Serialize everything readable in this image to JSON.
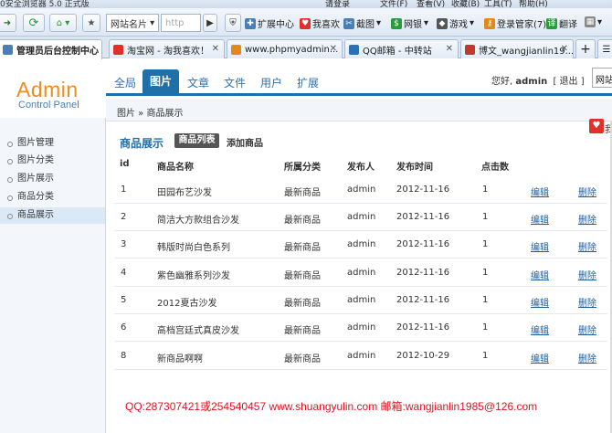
{
  "browser": {
    "title": "0安全浏览器 5.0 正式版",
    "menus": [
      "请登录",
      "文件(F)",
      "查看(V)",
      "收藏(B)",
      "工具(T)",
      "帮助(H)"
    ],
    "address_label": "网站名片",
    "address_value": "http",
    "toolbar_links": [
      {
        "label": "扩展中心",
        "icon": "puzzle-icon",
        "color": "#4a7fb5"
      },
      {
        "label": "我喜欢",
        "icon": "heart-icon",
        "color": "#e0302a"
      },
      {
        "label": "截图",
        "icon": "scissors-icon",
        "color": "#4a7fb5"
      },
      {
        "label": "网银",
        "icon": "bank-icon",
        "color": "#2a9a3a"
      },
      {
        "label": "游戏",
        "icon": "gamepad-icon",
        "color": "#555555"
      },
      {
        "label": "登录管家(7)",
        "icon": "key-icon",
        "color": "#e08a1e"
      },
      {
        "label": "翻译",
        "icon": "translate-icon",
        "color": "#2a9a3a"
      }
    ],
    "tabs": [
      {
        "label": "管理员后台控制中心",
        "active": true,
        "color": "#4a7fb5"
      },
      {
        "label": "淘宝网 - 淘我喜欢！",
        "active": false,
        "color": "#e0302a"
      },
      {
        "label": "www.phpmyadmin...",
        "active": false,
        "color": "#e08a1e"
      },
      {
        "label": "QQ邮箱 - 中转站",
        "active": false,
        "color": "#2a72b5"
      },
      {
        "label": "博文_wangjianlin19...",
        "active": false,
        "color": "#c0392b"
      }
    ]
  },
  "logo": {
    "title": "Admin",
    "subtitle": "Control Panel"
  },
  "nav": {
    "items": [
      "全局",
      "图片",
      "文章",
      "文件",
      "用户",
      "扩展"
    ],
    "active_index": 1
  },
  "user": {
    "greeting": "您好,",
    "name": "admin",
    "logout": "[ 退出 ]",
    "search_placeholder": "网站"
  },
  "breadcrumb": "图片 » 商品展示",
  "sidebar": {
    "items": [
      "图片管理",
      "图片分类",
      "图片展示",
      "商品分类",
      "商品展示"
    ],
    "active_index": 4
  },
  "content": {
    "title": "商品展示",
    "list_button": "商品列表",
    "add_button": "添加商品",
    "headers": {
      "id": "id",
      "name": "商品名称",
      "category": "所属分类",
      "publisher": "发布人",
      "time": "发布时间",
      "clicks": "点击数"
    },
    "edit_label": "编辑",
    "delete_label": "删除",
    "rows": [
      {
        "id": "1",
        "name": "田园布艺沙发",
        "category": "最新商品",
        "publisher": "admin",
        "time": "2012-11-16",
        "clicks": "1"
      },
      {
        "id": "2",
        "name": "简洁大方款组合沙发",
        "category": "最新商品",
        "publisher": "admin",
        "time": "2012-11-16",
        "clicks": "1"
      },
      {
        "id": "3",
        "name": "韩版时尚白色系列",
        "category": "最新商品",
        "publisher": "admin",
        "time": "2012-11-16",
        "clicks": "1"
      },
      {
        "id": "4",
        "name": "紫色幽雅系列沙发",
        "category": "最新商品",
        "publisher": "admin",
        "time": "2012-11-16",
        "clicks": "1"
      },
      {
        "id": "5",
        "name": "2012夏古沙发",
        "category": "最新商品",
        "publisher": "admin",
        "time": "2012-11-16",
        "clicks": "1"
      },
      {
        "id": "6",
        "name": "高档宫廷式真皮沙发",
        "category": "最新商品",
        "publisher": "admin",
        "time": "2012-11-16",
        "clicks": "1"
      },
      {
        "id": "8",
        "name": "新商品啊啊",
        "category": "最新商品",
        "publisher": "admin",
        "time": "2012-10-29",
        "clicks": "1"
      }
    ]
  },
  "footer": "QQ:287307421或254540457 www.shuangyulin.com 邮箱:wangjianlin1985@126.com",
  "side_widget": {
    "label": "我"
  }
}
